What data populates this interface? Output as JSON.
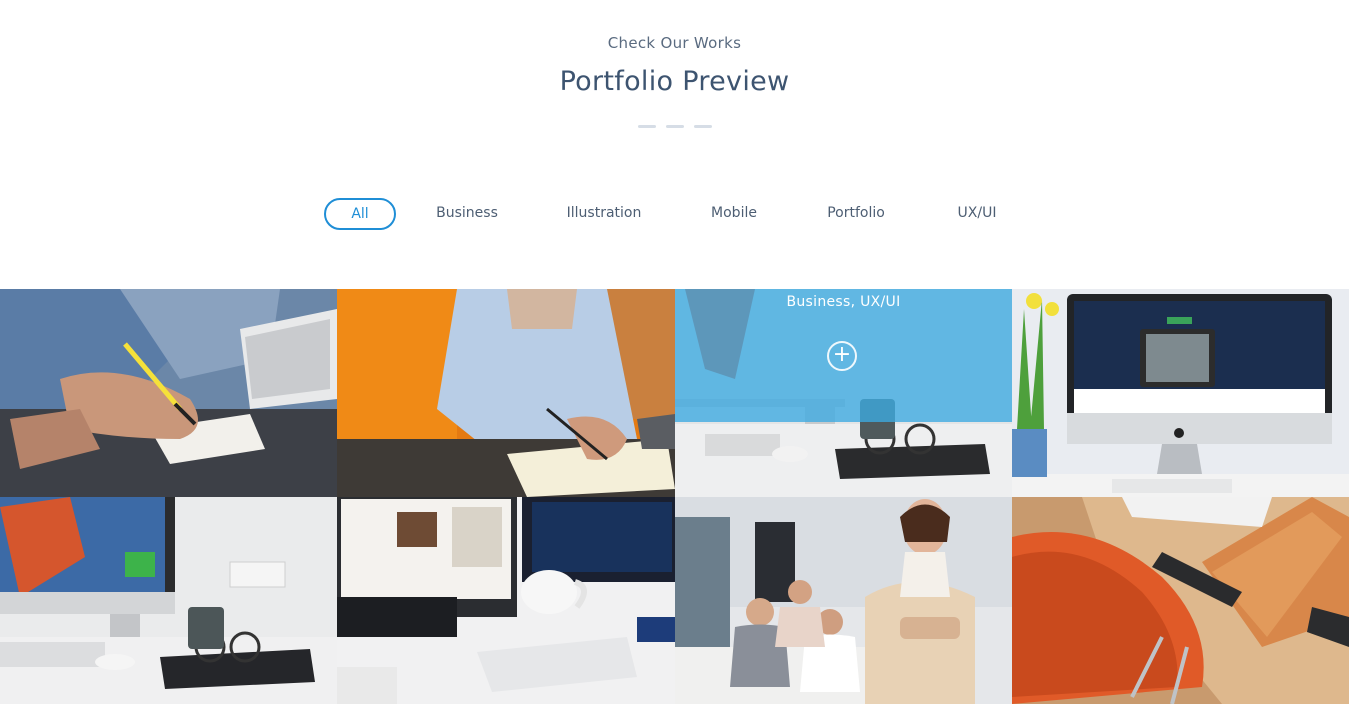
{
  "header": {
    "subtitle": "Check Our Works",
    "title": "Portfolio Preview"
  },
  "filters": {
    "items": [
      {
        "label": "All",
        "active": true
      },
      {
        "label": "Business",
        "active": false
      },
      {
        "label": "Illustration",
        "active": false
      },
      {
        "label": "Mobile",
        "active": false
      },
      {
        "label": "Portfolio",
        "active": false
      },
      {
        "label": "UX/UI",
        "active": false
      }
    ],
    "accent_color": "#1f8ed6"
  },
  "portfolio": {
    "hover_caption": "Business, UX/UI",
    "plus_icon": "+",
    "tiles": [
      {
        "subject": "hand-writing-notes-with-laptop"
      },
      {
        "subject": "man-writing-orange-wall"
      },
      {
        "subject": "imac-desk-glasses-hovered"
      },
      {
        "subject": "imac-website-flowers"
      },
      {
        "subject": "imac-desk-glasses"
      },
      {
        "subject": "dell-monitors-twitter-mug"
      },
      {
        "subject": "businesswoman-office-team"
      },
      {
        "subject": "orange-chair-desk-notebook"
      }
    ],
    "overlay_color": "#3caae1"
  }
}
